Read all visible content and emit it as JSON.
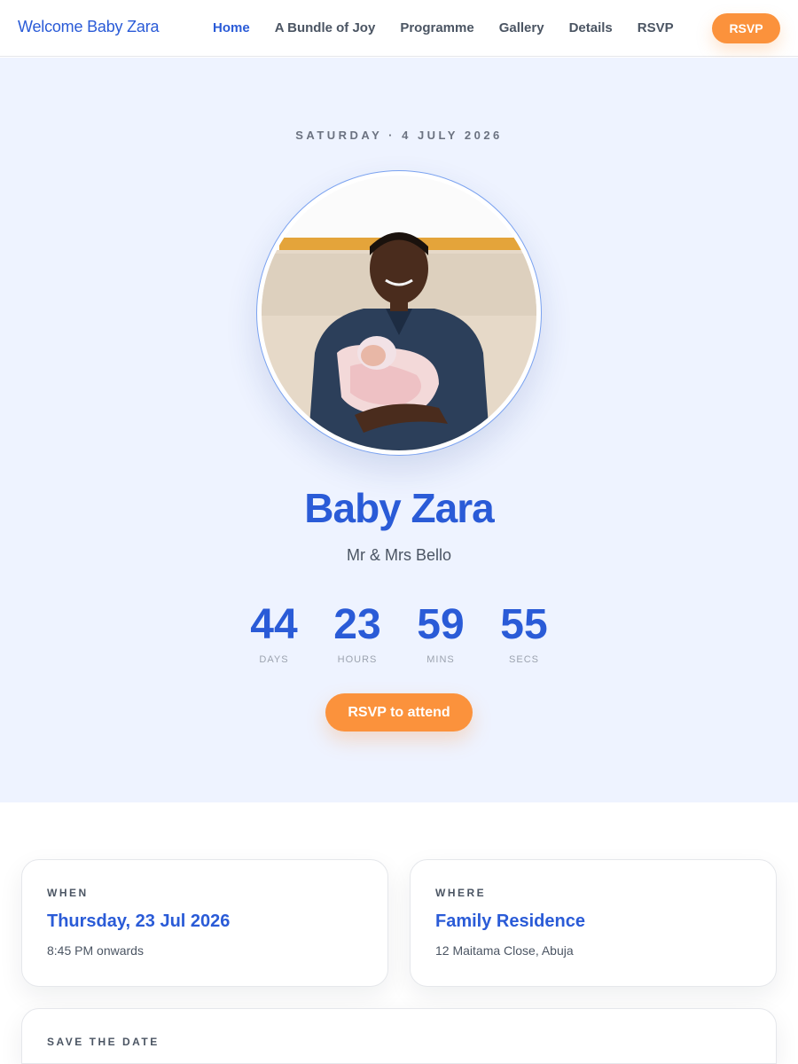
{
  "nav": {
    "brand": "Welcome Baby Zara",
    "links": [
      "Home",
      "A Bundle of Joy",
      "Programme",
      "Gallery",
      "Details",
      "RSVP"
    ],
    "active": "Home",
    "rsvp_button": "RSVP"
  },
  "hero": {
    "kicker": "SATURDAY · 4 JULY 2026",
    "title": "Baby Zara",
    "subtitle": "Mr & Mrs Bello",
    "countdown": [
      {
        "value": "44",
        "label": "DAYS"
      },
      {
        "value": "23",
        "label": "HOURS"
      },
      {
        "value": "59",
        "label": "MINS"
      },
      {
        "value": "55",
        "label": "SECS"
      }
    ],
    "cta": "RSVP to attend"
  },
  "cards": {
    "when": {
      "label": "WHEN",
      "main": "Thursday, 23 Jul 2026",
      "sub": "8:45 PM onwards"
    },
    "where": {
      "label": "WHERE",
      "main": "Family Residence",
      "sub": "12 Maitama Close, Abuja"
    },
    "save": {
      "label": "SAVE THE DATE"
    }
  },
  "colors": {
    "accent": "#2a5bd7",
    "cta": "#fb923c",
    "hero_bg": "#eef3ff"
  }
}
